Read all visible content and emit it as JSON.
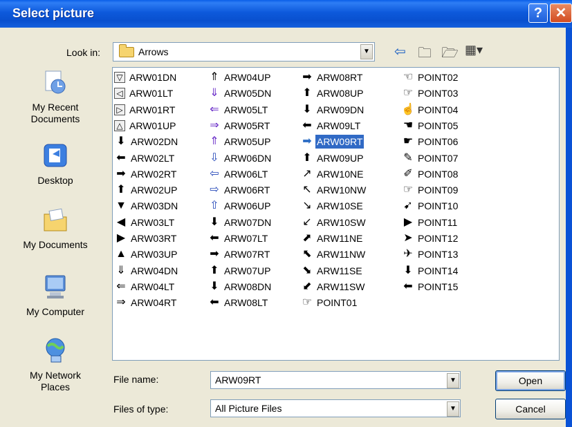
{
  "window": {
    "title": "Select picture"
  },
  "titlebar": {
    "help_icon": "help-icon",
    "close_icon": "close-icon"
  },
  "lookin": {
    "label": "Look in:",
    "value": "Arrows",
    "tools": [
      "back-arrow-icon",
      "up-folder-icon",
      "new-folder-icon",
      "views-menu-icon"
    ]
  },
  "places": [
    {
      "label": "My Recent Documents",
      "icon": "recent-documents-icon"
    },
    {
      "label": "Desktop",
      "icon": "desktop-icon"
    },
    {
      "label": "My Documents",
      "icon": "my-documents-icon"
    },
    {
      "label": "My Computer",
      "icon": "my-computer-icon"
    },
    {
      "label": "My Network Places",
      "icon": "network-places-icon"
    }
  ],
  "files": {
    "col1": [
      "ARW01DN",
      "ARW01LT",
      "ARW01RT",
      "ARW01UP",
      "ARW02DN",
      "ARW02LT",
      "ARW02RT",
      "ARW02UP",
      "ARW03DN",
      "ARW03LT",
      "ARW03RT",
      "ARW03UP",
      "ARW04DN",
      "ARW04LT",
      "ARW04RT"
    ],
    "col2": [
      "ARW04UP",
      "ARW05DN",
      "ARW05LT",
      "ARW05RT",
      "ARW05UP",
      "ARW06DN",
      "ARW06LT",
      "ARW06RT",
      "ARW06UP",
      "ARW07DN",
      "ARW07LT",
      "ARW07RT",
      "ARW07UP",
      "ARW08DN",
      "ARW08LT"
    ],
    "col3": [
      "ARW08RT",
      "ARW08UP",
      "ARW09DN",
      "ARW09LT",
      "ARW09RT",
      "ARW09UP",
      "ARW10NE",
      "ARW10NW",
      "ARW10SE",
      "ARW10SW",
      "ARW11NE",
      "ARW11NW",
      "ARW11SE",
      "ARW11SW",
      "POINT01"
    ],
    "col4": [
      "POINT02",
      "POINT03",
      "POINT04",
      "POINT05",
      "POINT06",
      "POINT07",
      "POINT08",
      "POINT09",
      "POINT10",
      "POINT11",
      "POINT12",
      "POINT13",
      "POINT14",
      "POINT15"
    ],
    "selected": "ARW09RT"
  },
  "filename": {
    "label": "File name:",
    "value": "ARW09RT"
  },
  "filetype": {
    "label": "Files of type:",
    "value": "All Picture Files"
  },
  "buttons": {
    "open": "Open",
    "cancel": "Cancel"
  },
  "colors": {
    "title_bar": "#0a5fe8",
    "selection": "#316ac5",
    "dialog_bg": "#ece9d8"
  }
}
